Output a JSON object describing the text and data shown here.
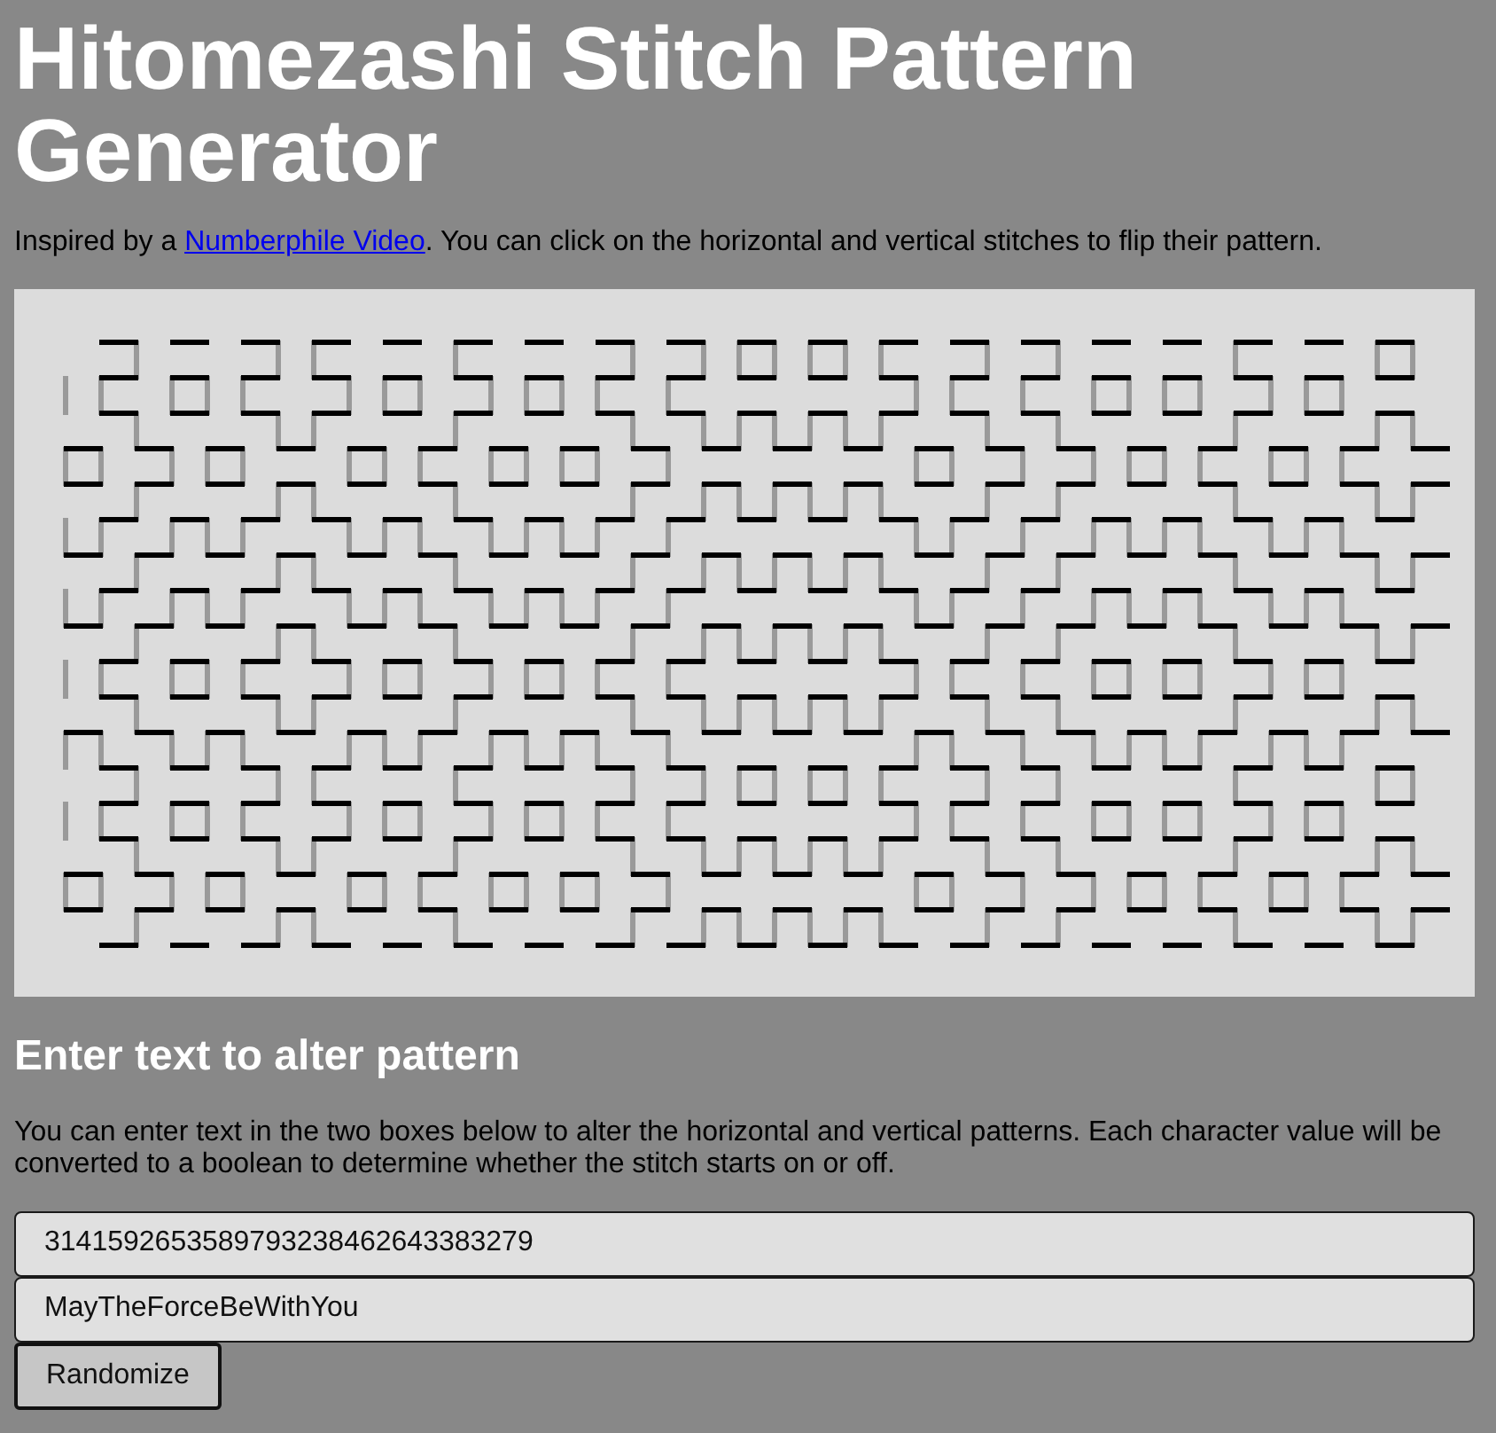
{
  "title": "Hitomezashi Stitch Pattern Generator",
  "intro": {
    "text_before_link": "Inspired by a ",
    "link": "Numberphile Video",
    "text_after_link": ". You can click on the horizontal and vertical stitches to flip their pattern."
  },
  "section": {
    "heading": "Enter text to alter pattern",
    "description": "You can enter text in the two boxes below to alter the horizontal and vertical patterns. Each character value will be converted to a boolean to determine whether the stitch starts on or off."
  },
  "inputs": [
    {
      "kind": "columns",
      "value": "3141592653589793238462643383279"
    },
    {
      "kind": "rows",
      "value": "MayTheForceBeWithYou"
    }
  ],
  "buttons": [
    {
      "label": "Randomize"
    }
  ]
}
